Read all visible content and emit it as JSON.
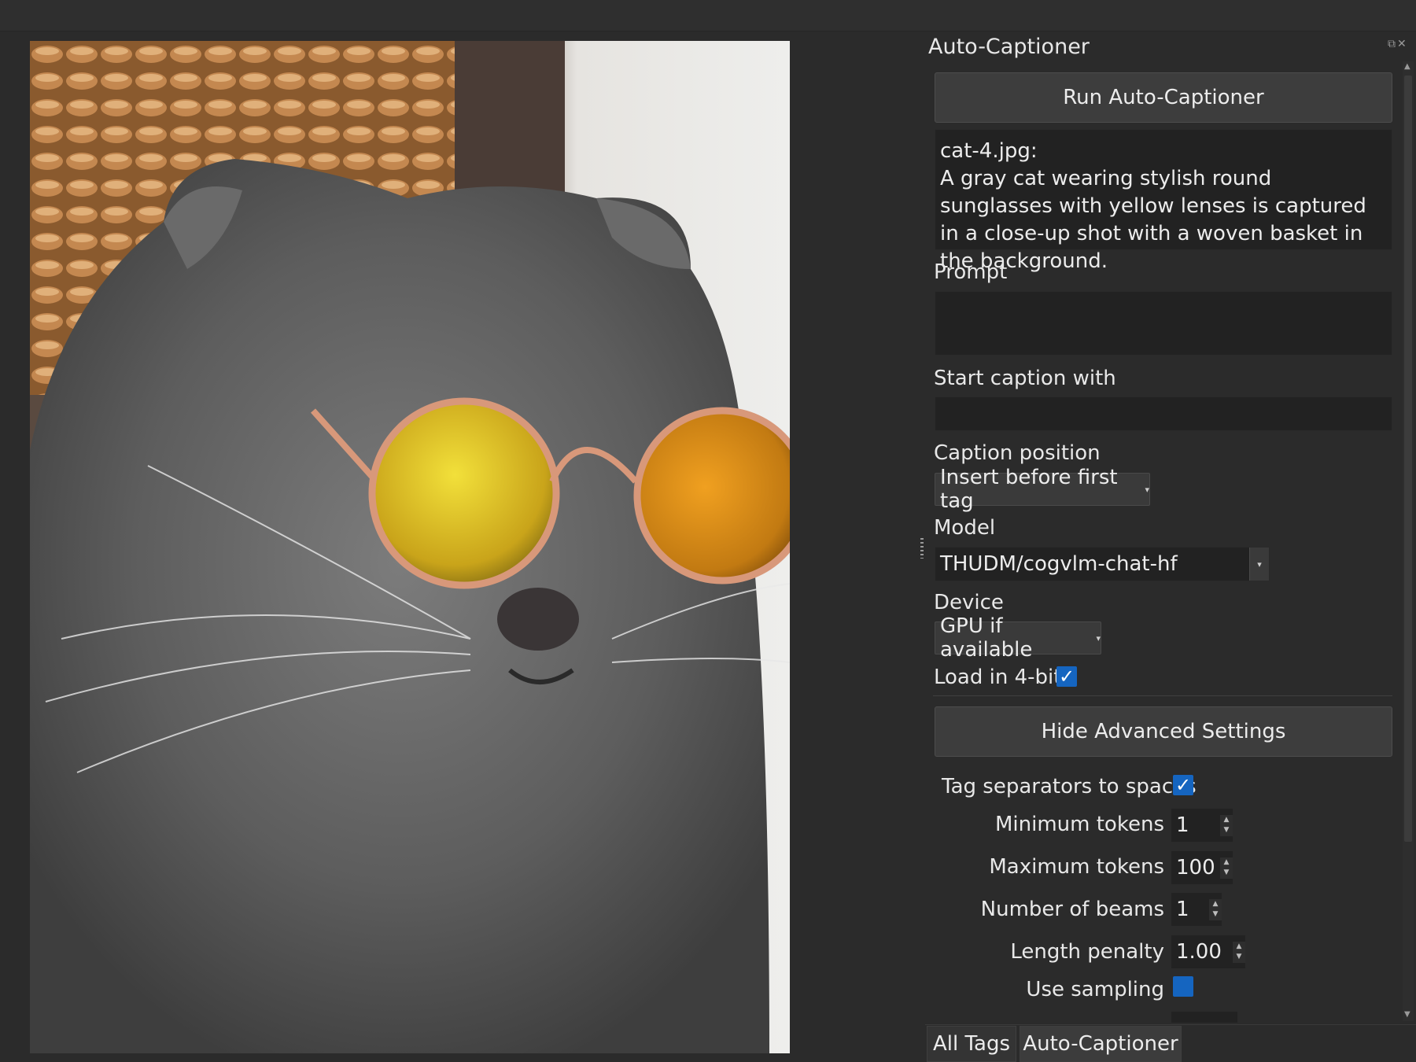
{
  "dock": {
    "title": "Auto-Captioner",
    "run_button": "Run Auto-Captioner",
    "caption_output": "cat-4.jpg:\nA gray cat wearing stylish round sunglasses with yellow lenses is captured in a close-up shot with a woven basket in the background.",
    "prompt_label": "Prompt",
    "prompt_value": "",
    "start_caption_label": "Start caption with",
    "start_caption_value": "",
    "caption_position_label": "Caption position",
    "caption_position_value": "Insert before first tag",
    "model_label": "Model",
    "model_value": "THUDM/cogvlm-chat-hf",
    "device_label": "Device",
    "device_value": "GPU if available",
    "load_4bit_label": "Load in 4-bit",
    "load_4bit_checked": true,
    "advanced_button": "Hide Advanced Settings",
    "advanced": {
      "tag_separators_label": "Tag separators to spaces",
      "tag_separators_checked": true,
      "min_tokens_label": "Minimum tokens",
      "min_tokens_value": "1",
      "max_tokens_label": "Maximum tokens",
      "max_tokens_value": "100",
      "num_beams_label": "Number of beams",
      "num_beams_value": "1",
      "length_penalty_label": "Length penalty",
      "length_penalty_value": "1.00",
      "use_sampling_label": "Use sampling",
      "use_sampling_checked": false
    }
  },
  "tabs": [
    "All Tags",
    "Auto-Captioner"
  ],
  "icons": {
    "check": "✓",
    "caret_down": "▾",
    "spin_up": "▲",
    "spin_down": "▼"
  },
  "colors": {
    "accent": "#1565c0",
    "background": "#2b2b2b",
    "input_bg": "#222222",
    "button_bg": "#3d3d3d"
  }
}
